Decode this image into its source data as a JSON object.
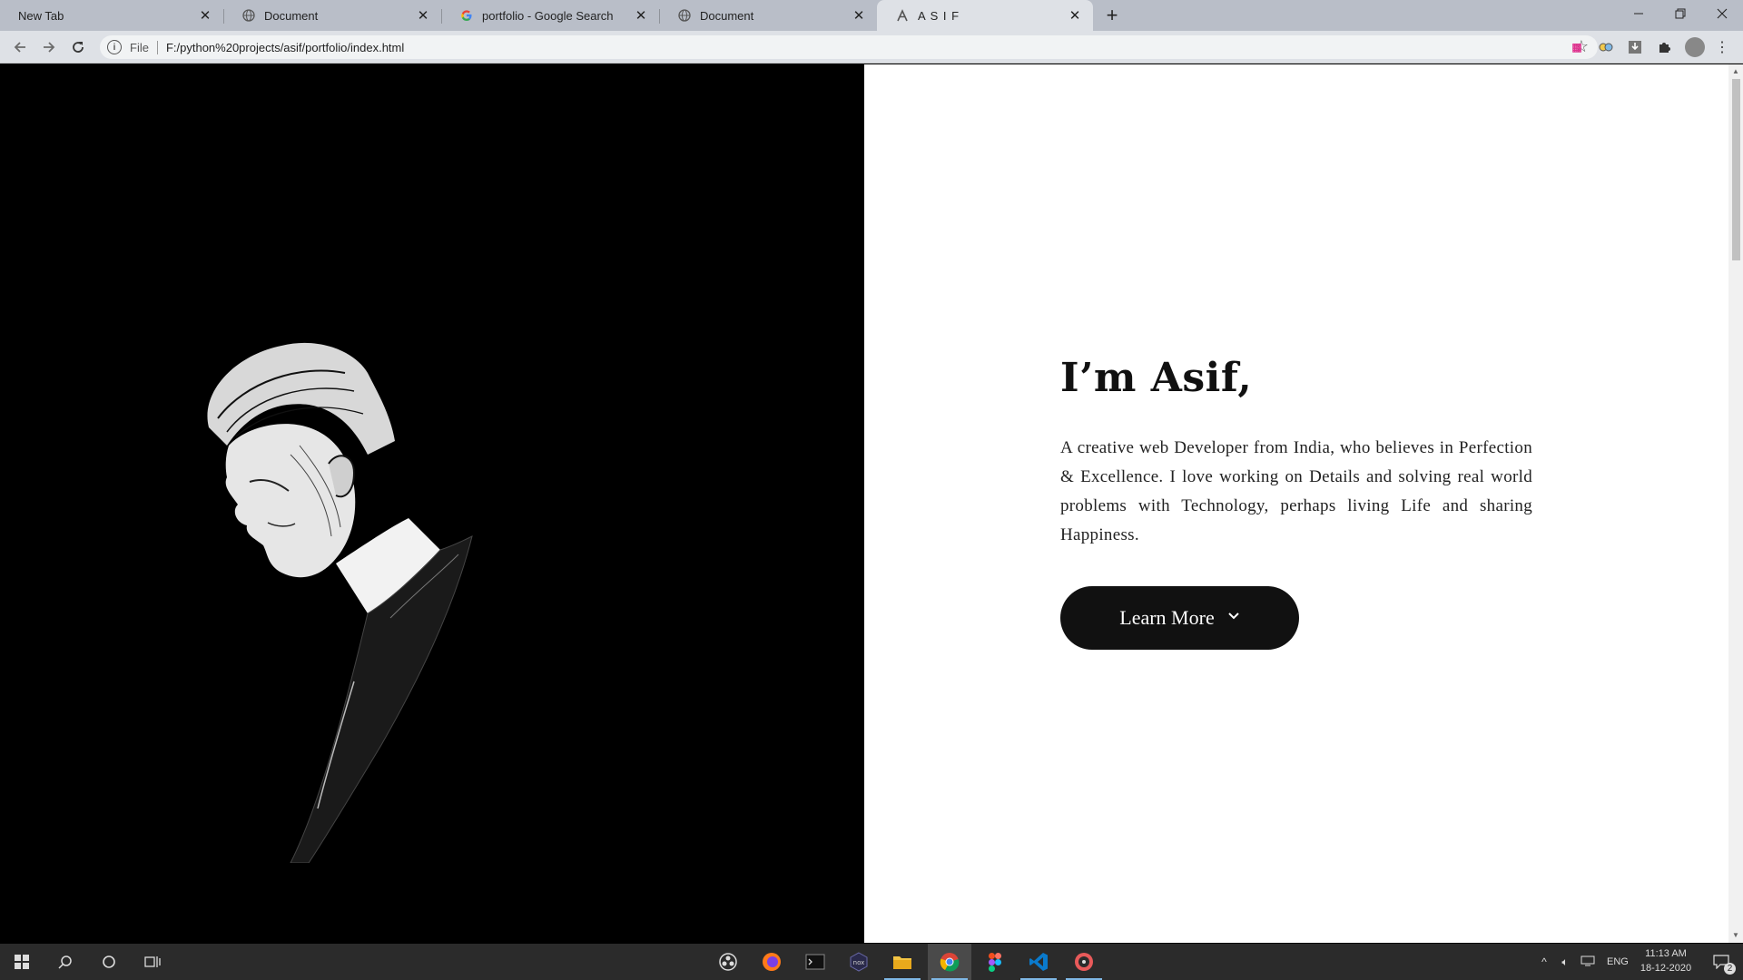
{
  "browser": {
    "tabs": [
      {
        "label": "New Tab",
        "icon": "none"
      },
      {
        "label": "Document",
        "icon": "globe-icon"
      },
      {
        "label": "portfolio - Google Search",
        "icon": "google-icon"
      },
      {
        "label": "Document",
        "icon": "globe-icon"
      },
      {
        "label": "A S I F",
        "icon": "logo-icon"
      }
    ],
    "omnibox": {
      "scheme": "File",
      "url": "F:/python%20projects/asif/portfolio/index.html"
    }
  },
  "hero": {
    "title": "I’m Asif,",
    "description": "A creative web Developer from India, who believes in Perfection & Excellence. I love working on Details and solving real world problems with Technology, perhaps living Life and sharing Happiness.",
    "button_label": "Learn More"
  },
  "taskbar": {
    "language": "ENG",
    "time": "11:13 AM",
    "date": "18-12-2020",
    "notification_count": "2"
  },
  "colors": {
    "accent_dark": "#111111",
    "tab_strip": "#b9bec8",
    "toolbar": "#dee1e6",
    "taskbar": "#2b2b2b"
  }
}
